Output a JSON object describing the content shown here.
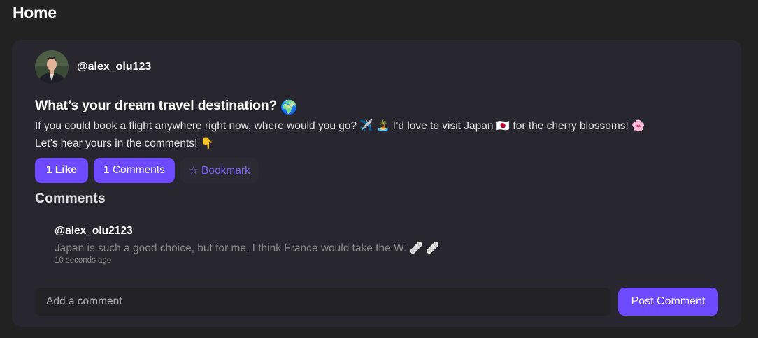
{
  "page": {
    "title": "Home"
  },
  "post": {
    "username": "@alex_olu123",
    "title": "What’s your dream travel destination?",
    "title_emoji": "🌍",
    "body_line1": "If you could book a flight anywhere right now, where would you go? ✈️ 🏝️ I’d love to visit Japan 🇯🇵 for the cherry blossoms! 🌸",
    "body_line2": "Let’s hear yours in the comments! 👇",
    "actions": {
      "like_label": "1 Like",
      "comments_label": "1 Comments",
      "bookmark_label": "☆ Bookmark"
    }
  },
  "comments": {
    "heading": "Comments",
    "items": [
      {
        "author": "@alex_olu2123",
        "text": "Japan is such a good choice, but for me, I think France would take the W. 🩹 🩹",
        "time": "10 seconds ago"
      }
    ]
  },
  "composer": {
    "placeholder": "Add a comment",
    "value": "",
    "submit_label": "Post Comment"
  },
  "colors": {
    "background": "#222222",
    "card": "#28262f",
    "accent": "#6d4aff",
    "input_bg": "#232225",
    "muted_text": "#8a8a8a"
  }
}
